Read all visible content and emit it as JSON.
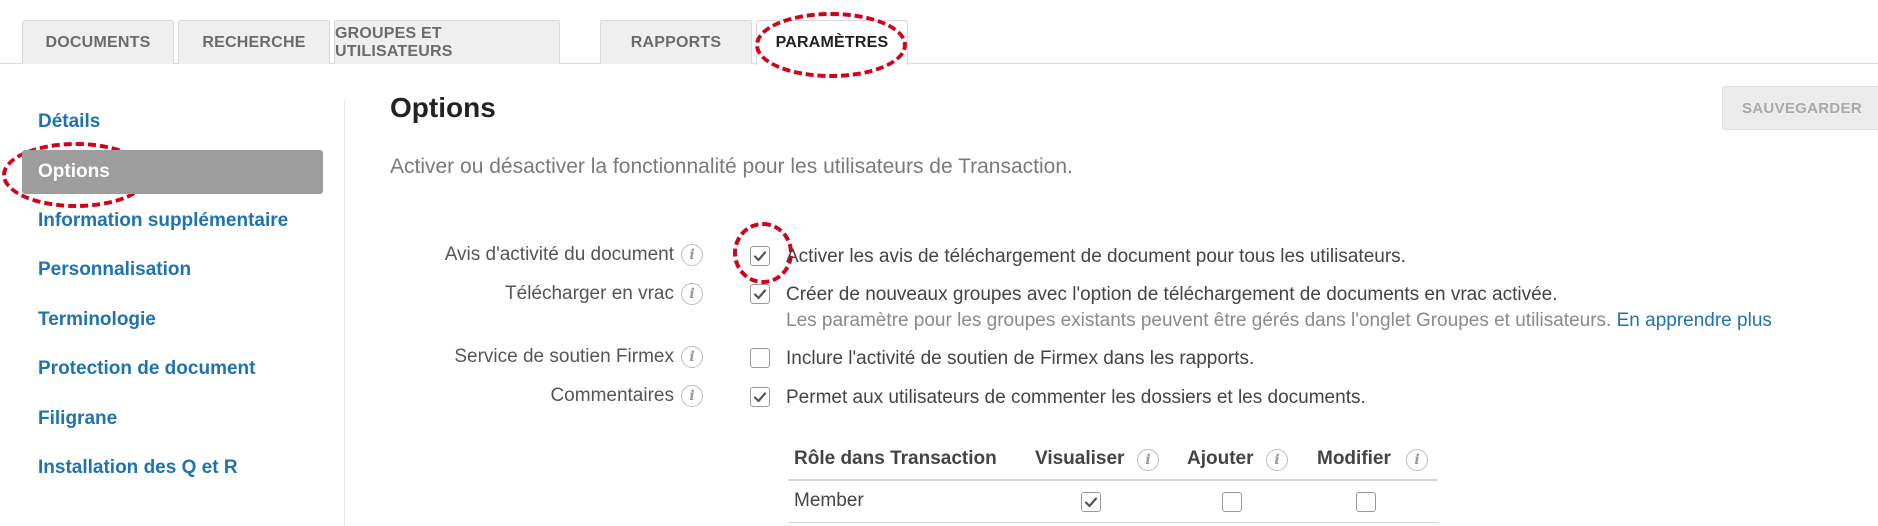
{
  "tabs": [
    {
      "label": "DOCUMENTS"
    },
    {
      "label": "RECHERCHE"
    },
    {
      "label": "GROUPES ET UTILISATEURS"
    },
    {
      "label": "RAPPORTS"
    },
    {
      "label": "PARAMÈTRES",
      "active": true
    }
  ],
  "sidebar": {
    "items": [
      {
        "label": "Détails"
      },
      {
        "label": "Options",
        "active": true
      },
      {
        "label": "Information supplémentaire"
      },
      {
        "label": "Personnalisation"
      },
      {
        "label": "Terminologie"
      },
      {
        "label": "Protection de document"
      },
      {
        "label": "Filigrane"
      },
      {
        "label": "Installation des Q et R"
      }
    ]
  },
  "main": {
    "title": "Options",
    "subtitle": "Activer ou désactiver la fonctionnalité pour les utilisateurs de Transaction.",
    "save_label": "SAUVEGARDER",
    "options": [
      {
        "label": "Avis d'activité du document",
        "checked": true,
        "text": "Activer les avis de téléchargement de document pour tous les utilisateurs."
      },
      {
        "label": "Télécharger en vrac",
        "checked": true,
        "text": "Créer de nouveaux groupes avec l'option de téléchargement de documents en vrac activée.",
        "sub_text": "Les paramètre pour les groupes existants peuvent être gérés dans l'onglet Groupes et utilisateurs.",
        "sub_link": "En apprendre plus"
      },
      {
        "label": "Service de soutien Firmex",
        "checked": false,
        "text": "Inclure l'activité de soutien de Firmex dans les rapports."
      },
      {
        "label": "Commentaires",
        "checked": true,
        "text": "Permet aux utilisateurs de commenter les dossiers et les documents."
      }
    ],
    "info_icon": "info-icon",
    "role_table": {
      "headers": [
        "Rôle dans Transaction",
        "Visualiser",
        "Ajouter",
        "Modifier"
      ],
      "rows": [
        {
          "role": "Member",
          "visualiser": true,
          "ajouter": false,
          "modifier": false
        }
      ]
    }
  },
  "colors": {
    "link": "#1e73b5",
    "active_sidebar": "#9d9d9d",
    "annotation": "#d0021b"
  }
}
